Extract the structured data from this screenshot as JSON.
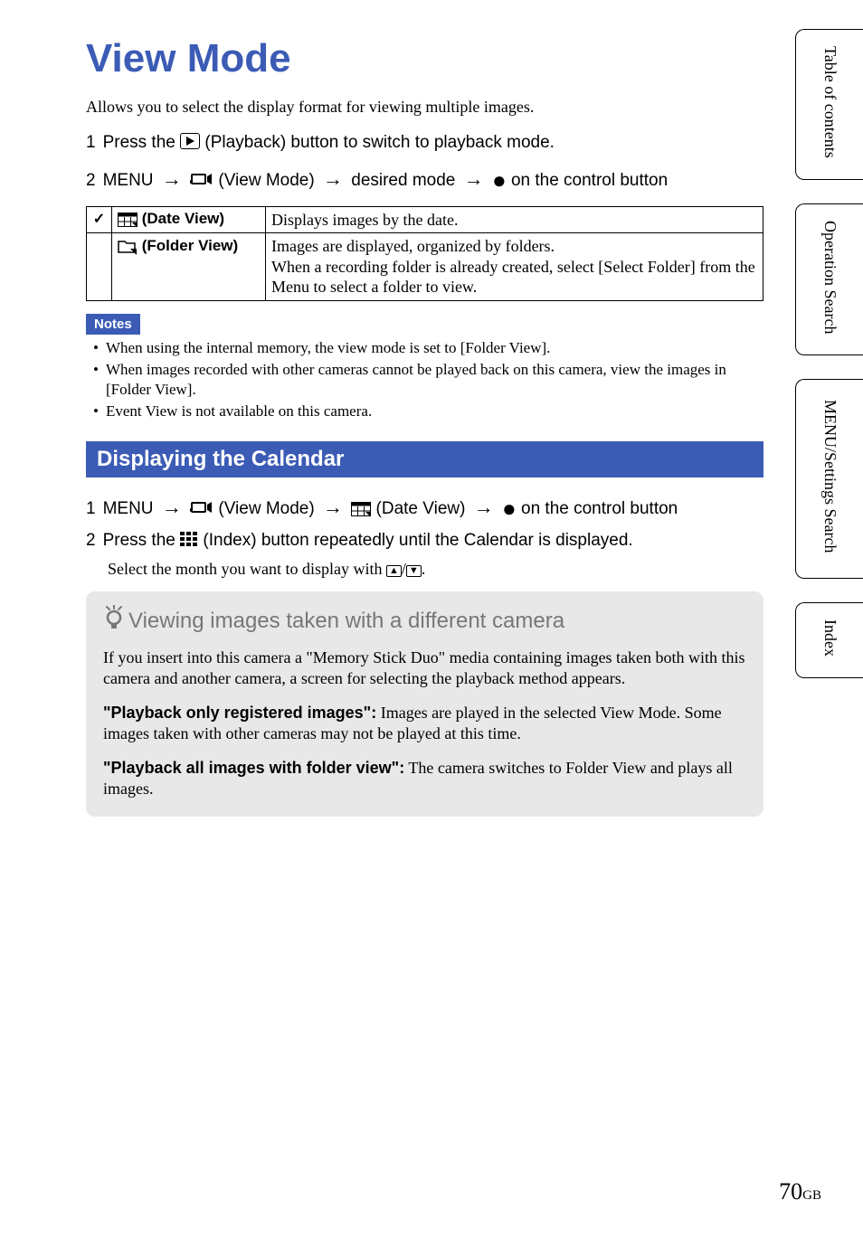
{
  "page": {
    "title": "View Mode",
    "intro": "Allows you to select the display format for viewing multiple images.",
    "step1_num": "1",
    "step1_a": "Press the ",
    "step1_b": " (Playback) button to switch to playback mode.",
    "step2_num": "2",
    "step2_a": "MENU ",
    "step2_b": " (View Mode) ",
    "step2_c": " desired mode ",
    "step2_d": " on the control button"
  },
  "table": {
    "row1": {
      "label": "(Date View)",
      "desc": "Displays images by the date."
    },
    "row2": {
      "label": "(Folder View)",
      "desc": "Images are displayed, organized by folders.\nWhen a recording folder is already created, select [Select Folder] from the Menu to select a folder to view."
    }
  },
  "notes": {
    "header": "Notes",
    "n1": "When using the internal memory, the view mode is set to [Folder View].",
    "n2": "When images recorded with other cameras cannot be played back on this camera, view the images in [Folder View].",
    "n3": "Event View is not available on this camera."
  },
  "section": {
    "title": "Displaying the Calendar",
    "s1_num": "1",
    "s1_a": "MENU ",
    "s1_b": " (View Mode) ",
    "s1_c": " (Date View) ",
    "s1_d": " on the control button",
    "s2_num": "2",
    "s2_a": "Press the ",
    "s2_b": " (Index) button repeatedly until the Calendar is displayed.",
    "s2_sub_a": "Select the month you want to display with ",
    "s2_sub_b": "/",
    "s2_sub_c": "."
  },
  "tip": {
    "title": "Viewing images taken with a different camera",
    "p1": "If you insert into this camera a \"Memory Stick Duo\" media containing images taken both with this camera and another camera, a screen for selecting the playback method appears.",
    "p2_lead": "\"Playback only registered images\":",
    "p2_body": " Images are played in the selected View Mode. Some images taken with other cameras may not be played at this time.",
    "p3_lead": "\"Playback all images with folder view\":",
    "p3_body": " The camera switches to Folder View and plays all images."
  },
  "sidebar": {
    "t1": "Table of contents",
    "t2": "Operation Search",
    "t3": "MENU/Settings Search",
    "t4": "Index"
  },
  "pagenum": {
    "num": "70",
    "suffix": "GB"
  }
}
